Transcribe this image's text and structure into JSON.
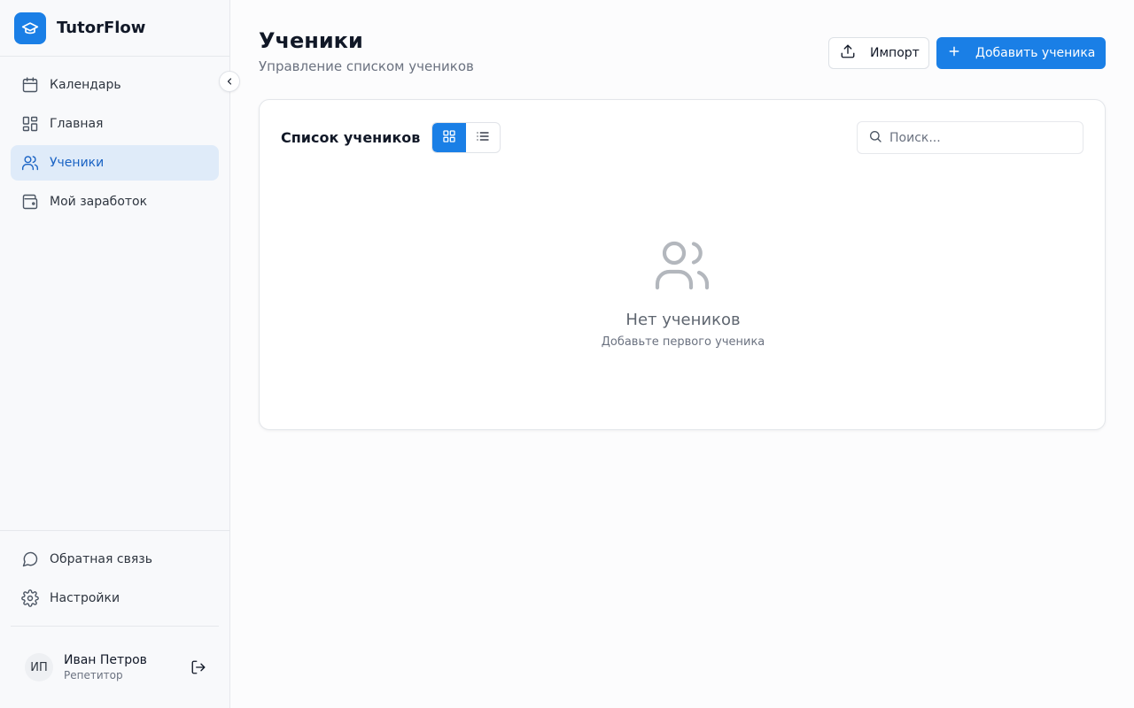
{
  "app": {
    "name": "TutorFlow"
  },
  "sidebar": {
    "items": [
      {
        "label": "Календарь",
        "icon": "calendar-icon"
      },
      {
        "label": "Главная",
        "icon": "dashboard-icon"
      },
      {
        "label": "Ученики",
        "icon": "users-icon",
        "active": true
      },
      {
        "label": "Мой заработок",
        "icon": "wallet-icon"
      }
    ],
    "bottom_items": [
      {
        "label": "Обратная связь",
        "icon": "message-circle-icon"
      },
      {
        "label": "Настройки",
        "icon": "gear-icon"
      }
    ],
    "user": {
      "initials": "ИП",
      "name": "Иван Петров",
      "role": "Репетитор"
    }
  },
  "header": {
    "title": "Ученики",
    "subtitle": "Управление списком учеников",
    "import_label": "Импорт",
    "add_label": "Добавить ученика"
  },
  "card": {
    "title": "Список учеников",
    "search_placeholder": "Поиск...",
    "active_view": "grid",
    "empty_title": "Нет учеников",
    "empty_subtitle": "Добавьте первого ученика"
  },
  "colors": {
    "accent": "#1a7fe6",
    "active_bg": "#dfebf9",
    "active_text": "#1a63c4"
  }
}
